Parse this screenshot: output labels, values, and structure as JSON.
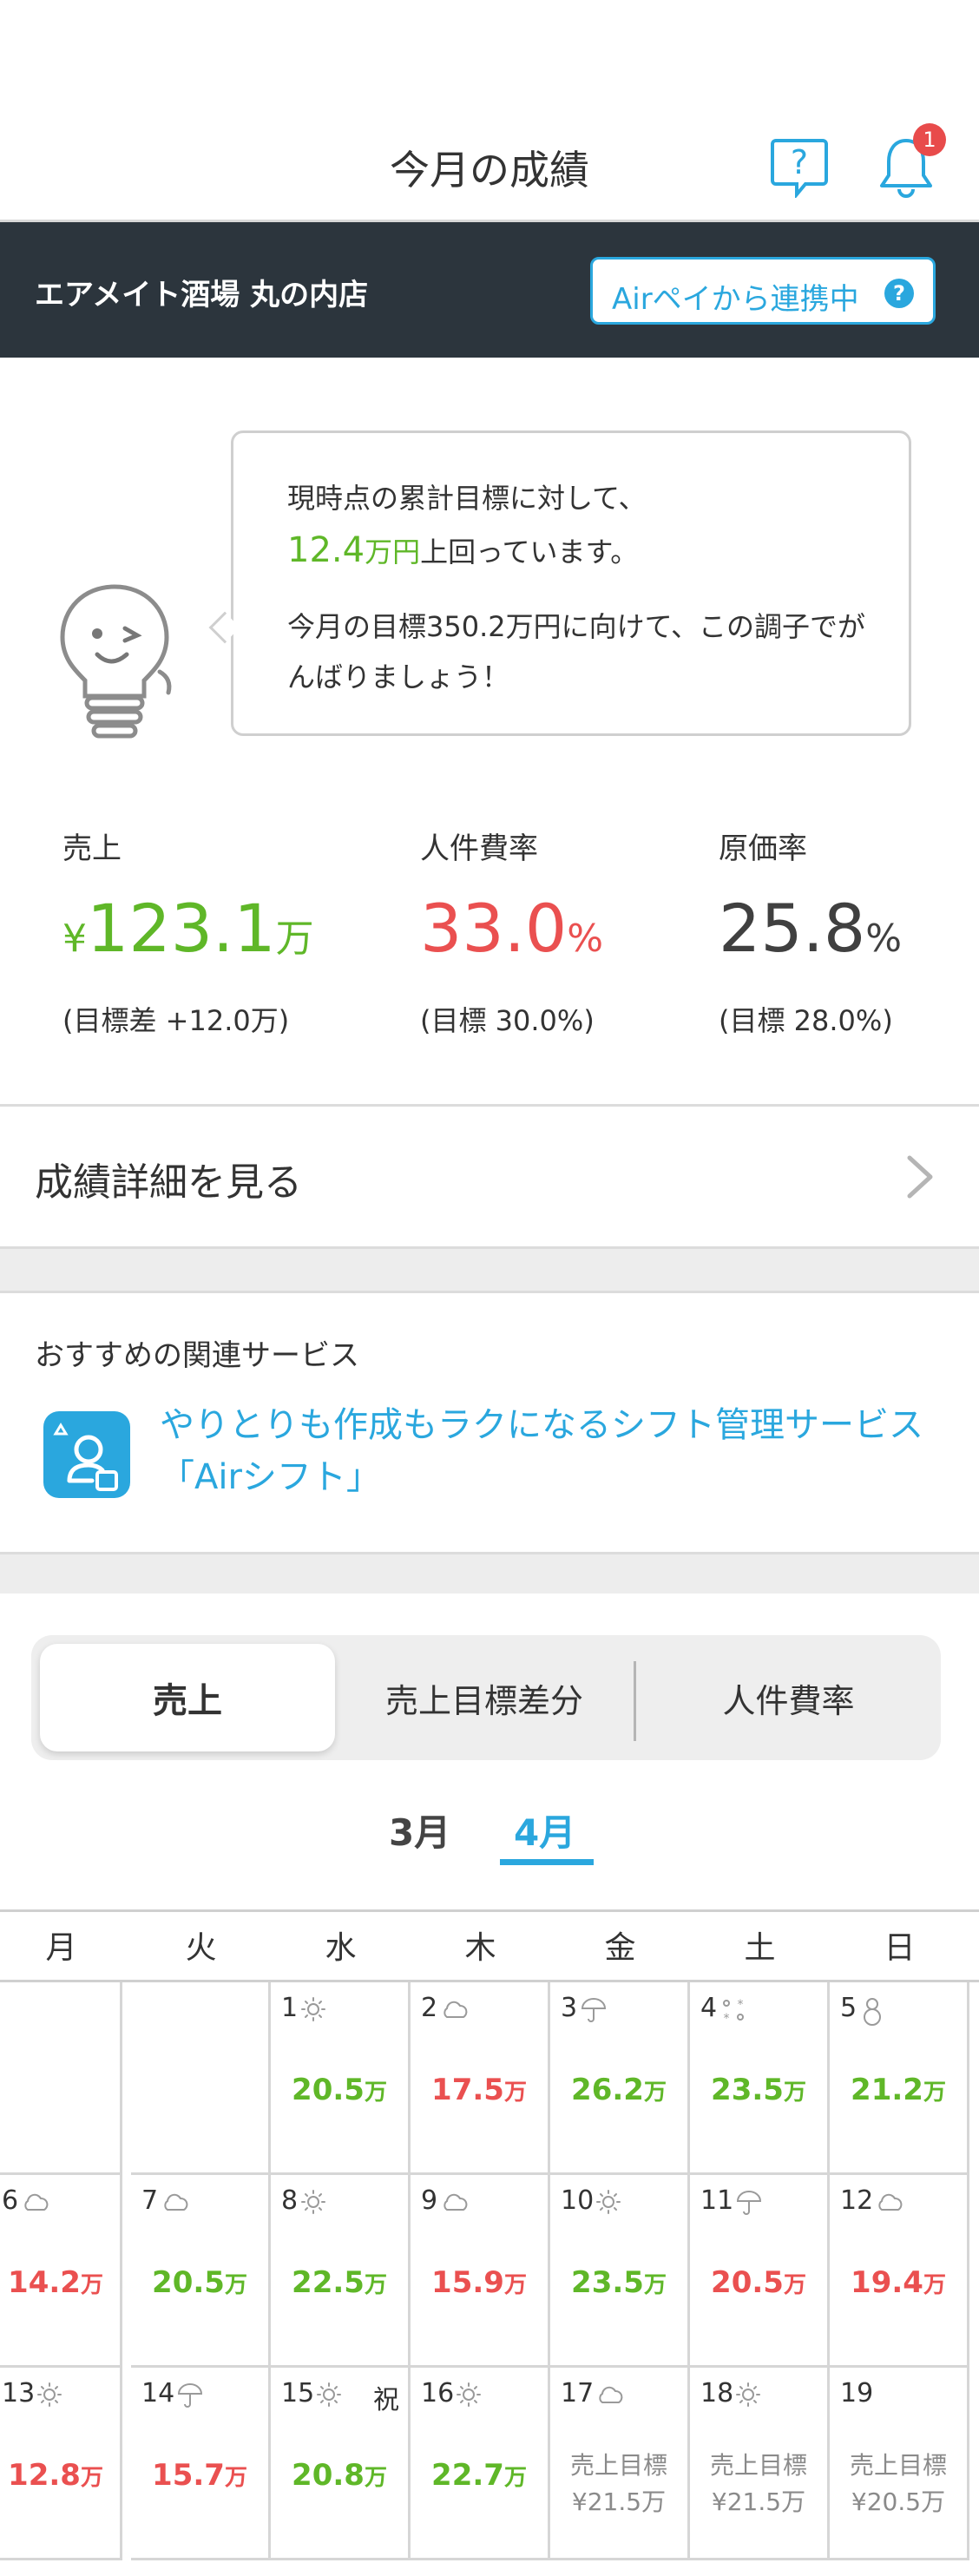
{
  "header": {
    "title": "今月の成績",
    "notification_count": "1"
  },
  "store": {
    "name": "エアメイト酒場 丸の内店",
    "link_label": "Airペイから連携中",
    "link_help": "?"
  },
  "message": {
    "line1": "現時点の累計目標に対して、",
    "amount_num": "12.4",
    "amount_unit": "万円",
    "line2_rest": "上回っています。",
    "line3": "今月の目標350.2万円に向けて、この調子でがんばりましょう！"
  },
  "metrics": {
    "sales": {
      "label": "売上",
      "prefix": "¥",
      "value": "123.1",
      "unit": "万",
      "sub": "(目標差 +12.0万)",
      "color": "#5fb728"
    },
    "labor": {
      "label": "人件費率",
      "value": "33.0",
      "unit": "%",
      "sub": "(目標 30.0%)",
      "color": "#ea5050"
    },
    "cost": {
      "label": "原価率",
      "value": "25.8",
      "unit": "%",
      "sub": "(目標 28.0%)",
      "color": "#404040"
    }
  },
  "detail_link": "成績詳細を見る",
  "recommend": {
    "title": "おすすめの関連サービス",
    "link": "やりとりも作成もラクになるシフト管理サービス「Airシフト」",
    "icon": "shift-app-icon"
  },
  "segments": {
    "items": [
      "売上",
      "売上目標差分",
      "人件費率"
    ],
    "active": "売上"
  },
  "months": {
    "prev": "3月",
    "current": "4月"
  },
  "calendar": {
    "weekdays": [
      "月",
      "火",
      "水",
      "木",
      "金",
      "土",
      "日"
    ],
    "unit": "万",
    "target_label": "売上目標",
    "rows": [
      [
        null,
        null,
        {
          "day": "1",
          "weather": "sunny",
          "value": "20.5",
          "status": "good"
        },
        {
          "day": "2",
          "weather": "cloudy",
          "value": "17.5",
          "status": "bad"
        },
        {
          "day": "3",
          "weather": "rain",
          "value": "26.2",
          "status": "good"
        },
        {
          "day": "4",
          "weather": "snow",
          "value": "23.5",
          "status": "good"
        },
        {
          "day": "5",
          "weather": "snowman",
          "value": "21.2",
          "status": "good"
        }
      ],
      [
        {
          "day": "6",
          "weather": "cloudy",
          "value": "14.2",
          "status": "bad"
        },
        {
          "day": "7",
          "weather": "cloudy",
          "value": "20.5",
          "status": "good"
        },
        {
          "day": "8",
          "weather": "sunny",
          "value": "22.5",
          "status": "good"
        },
        {
          "day": "9",
          "weather": "cloudy",
          "value": "15.9",
          "status": "bad"
        },
        {
          "day": "10",
          "weather": "sunny",
          "value": "23.5",
          "status": "good"
        },
        {
          "day": "11",
          "weather": "rain",
          "value": "20.5",
          "status": "bad"
        },
        {
          "day": "12",
          "weather": "cloudy",
          "value": "19.4",
          "status": "bad"
        }
      ],
      [
        {
          "day": "13",
          "weather": "sunny",
          "value": "12.8",
          "status": "bad"
        },
        {
          "day": "14",
          "weather": "rain",
          "value": "15.7",
          "status": "bad"
        },
        {
          "day": "15",
          "weather": "sunny",
          "holiday": "祝",
          "value": "20.8",
          "status": "good"
        },
        {
          "day": "16",
          "weather": "sunny",
          "value": "22.7",
          "status": "good"
        },
        {
          "day": "17",
          "weather": "cloudy",
          "target": "¥21.5万"
        },
        {
          "day": "18",
          "weather": "sunny",
          "target": "¥21.5万"
        },
        {
          "day": "19",
          "weather": "",
          "target": "¥20.5万"
        }
      ]
    ]
  },
  "colors": {
    "good": "#5fb728",
    "bad": "#ea5050",
    "accent": "#2aa7de",
    "dark_bar": "#2c353d"
  }
}
